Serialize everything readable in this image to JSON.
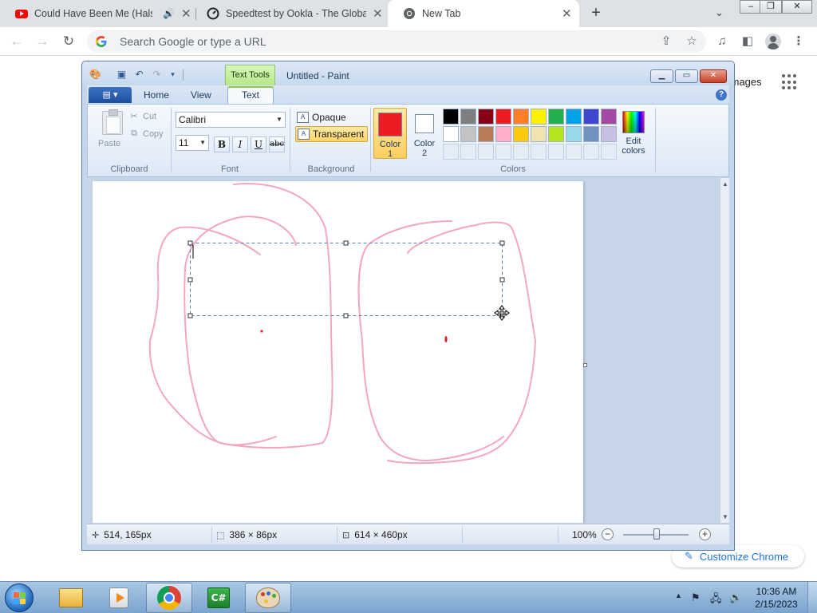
{
  "browser": {
    "tabs": [
      {
        "title": "Could Have Been Me (Halsey",
        "icon": "youtube-icon",
        "audio": true
      },
      {
        "title": "Speedtest by Ookla - The Global",
        "icon": "speedtest-icon"
      },
      {
        "title": "New Tab",
        "icon": "chrome-icon",
        "active": true
      }
    ],
    "omnibox_placeholder": "Search Google or type a URL",
    "ntp": {
      "images_link": "Images",
      "customize_label": "Customize Chrome"
    }
  },
  "paint": {
    "context_tab_label": "Text Tools",
    "window_title": "Untitled - Paint",
    "ribbon_tabs": [
      "Home",
      "View",
      "Text"
    ],
    "active_tab": "Text",
    "clipboard": {
      "paste": "Paste",
      "cut": "Cut",
      "copy": "Copy",
      "label": "Clipboard"
    },
    "font": {
      "family": "Calibri",
      "size": "11",
      "bold": "B",
      "italic": "I",
      "underline": "U",
      "strike": "abc",
      "label": "Font"
    },
    "background": {
      "opaque": "Opaque",
      "transparent": "Transparent",
      "label": "Background",
      "selected": "Transparent"
    },
    "colors": {
      "color1_label": "Color",
      "color1_num": "1",
      "color1_value": "#ed1c24",
      "color2_label": "Color",
      "color2_num": "2",
      "color2_value": "#ffffff",
      "edit_label": "Edit colors",
      "label": "Colors",
      "palette_row1": [
        "#000000",
        "#7f7f7f",
        "#880015",
        "#ed1c24",
        "#ff7f27",
        "#fff200",
        "#22b14c",
        "#00a2e8",
        "#3f48cc",
        "#a349a4"
      ],
      "palette_row2": [
        "#ffffff",
        "#c3c3c3",
        "#b97a57",
        "#ffaec9",
        "#ffc90e",
        "#efe4b0",
        "#b5e61d",
        "#99d9ea",
        "#7092be",
        "#c8bfe7"
      ]
    },
    "status": {
      "cursor_pos": "514, 165px",
      "selection_size": "386 × 86px",
      "image_size": "614 × 460px",
      "zoom": "100%"
    },
    "stroke_color": "#f4a6bf",
    "dot_color": "#d9252a"
  },
  "taskbar": {
    "time": "10:36 AM",
    "date": "2/15/2023",
    "items": [
      "explorer-icon",
      "media-player-icon",
      "chrome-icon",
      "csharp-icon",
      "paint-icon"
    ]
  }
}
